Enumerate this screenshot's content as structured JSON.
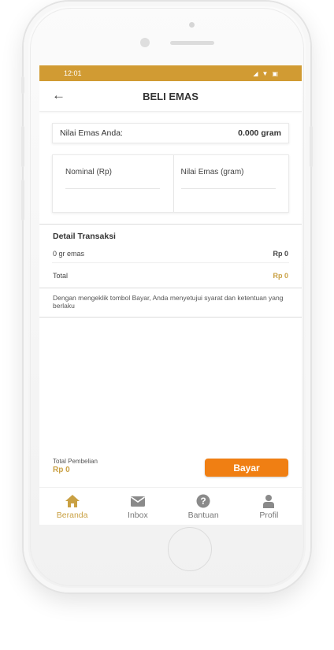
{
  "status": {
    "time": "12:01"
  },
  "header": {
    "title": "BELI EMAS"
  },
  "gold_balance": {
    "label": "Nilai Emas Anda:",
    "value": "0.000 gram"
  },
  "inputs": {
    "nominal_label": "Nominal (Rp)",
    "gold_label": "Nilai Emas (gram)"
  },
  "detail": {
    "title": "Detail Transaksi",
    "rows": [
      {
        "label": "0 gr emas",
        "amount": "Rp 0"
      },
      {
        "label": "Total",
        "amount": "Rp 0"
      }
    ]
  },
  "terms": "Dengan mengeklik tombol Bayar, Anda menyetujui syarat dan ketentuan yang berlaku",
  "purchase": {
    "label": "Total Pembelian",
    "value": "Rp 0",
    "button": "Bayar"
  },
  "nav": [
    {
      "label": "Beranda",
      "icon": "home-icon",
      "active": true
    },
    {
      "label": "Inbox",
      "icon": "mail-icon"
    },
    {
      "label": "Bantuan",
      "icon": "help-icon"
    },
    {
      "label": "Profil",
      "icon": "user-icon"
    }
  ],
  "colors": {
    "accent": "#d19b33",
    "gold_text": "#c9a043",
    "button": "#f07f13"
  }
}
